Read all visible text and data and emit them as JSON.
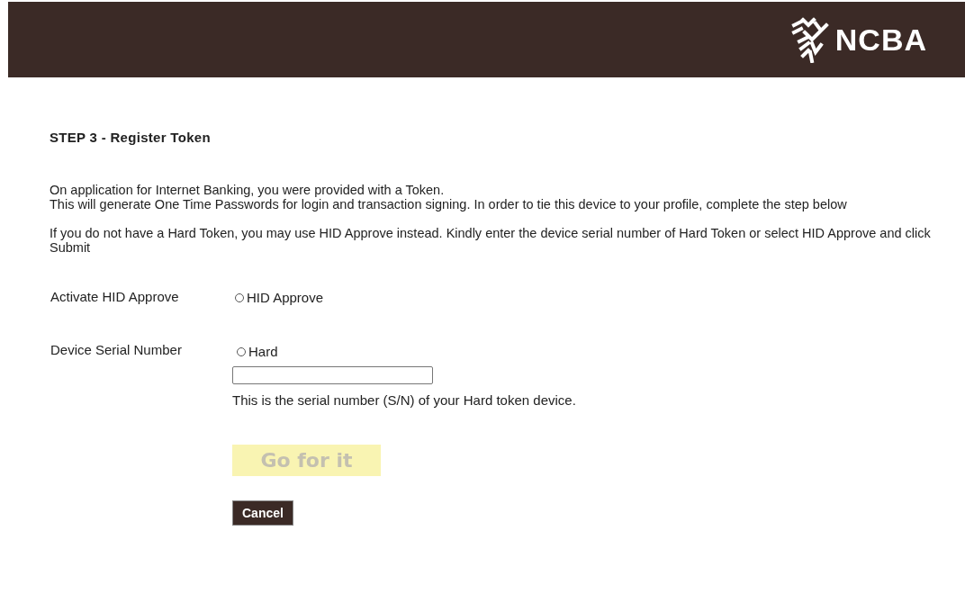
{
  "header": {
    "logo_text": "NCBA"
  },
  "title": "STEP 3 - Register Token",
  "paragraphs": [
    [
      "On application for Internet Banking, you were provided with a Token.",
      "This will generate One Time Passwords for login and transaction signing. In order to tie this device to your profile, complete the step below"
    ],
    [
      "If you do not have a Hard Token, you may use HID Approve instead. Kindly enter the device serial number of Hard Token or select HID Approve and click Submit"
    ]
  ],
  "fields": [
    {
      "kind": "radio",
      "label": "Activate HID Approve",
      "option": "HID Approve",
      "selected": false
    },
    {
      "kind": "serial",
      "label": "Device Serial Number",
      "option": "Hard",
      "selected": false,
      "hint": "This is the serial number (S/N) of your Hard token device."
    }
  ],
  "submit": {
    "label": "Go for it",
    "disabled": true
  },
  "cancel": {
    "label": "Cancel"
  }
}
